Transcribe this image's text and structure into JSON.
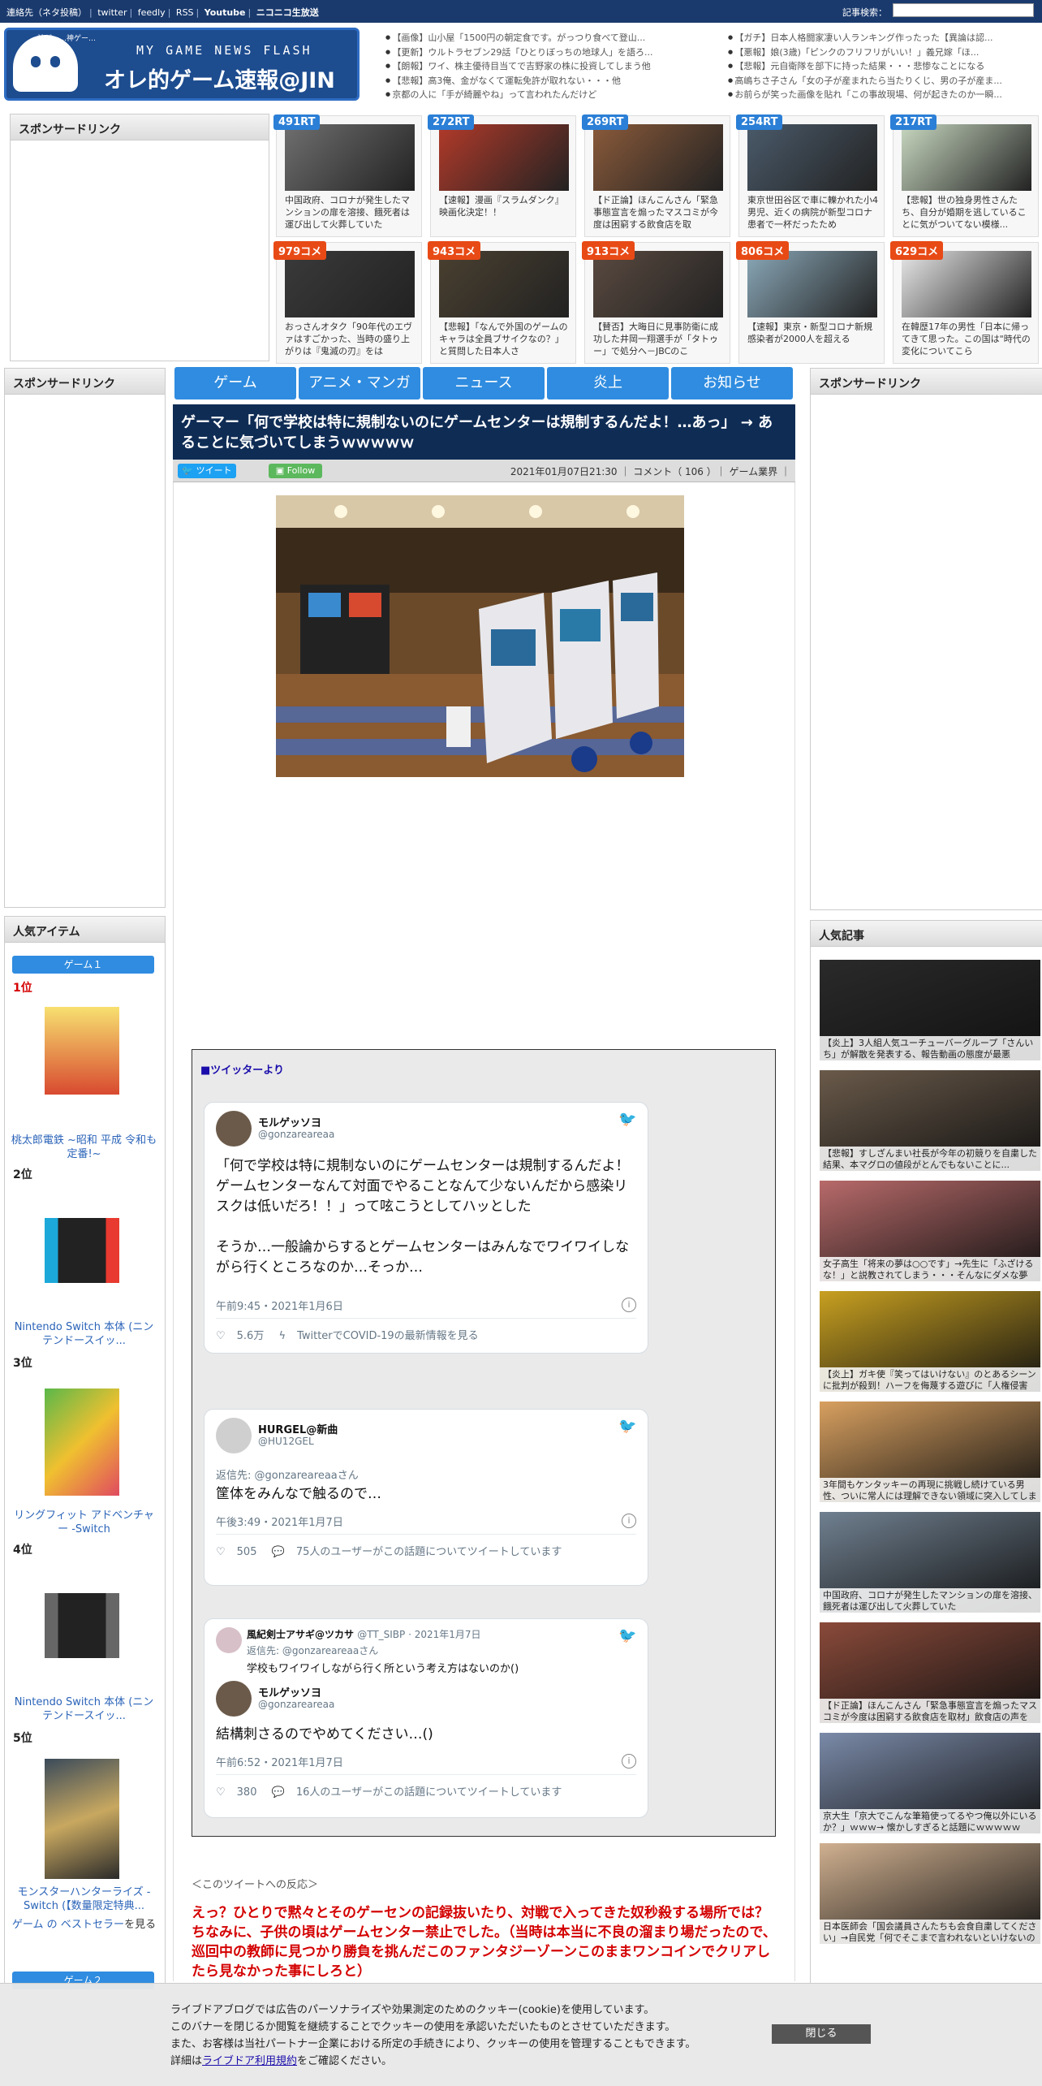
{
  "topbar": {
    "links": [
      "連絡先（ネタ投稿）",
      "twitter",
      "feedly",
      "RSS",
      "Youtube",
      "ニコニコ生放送"
    ],
    "search_label": "記事検索："
  },
  "logo": {
    "top": "MY GAME NEWS FLASH",
    "main": "オレ的ゲーム速報@JIN",
    "side": "神ゲー…神ゲー…"
  },
  "headlines_left": [
    "【画像】山小屋「1500円の朝定食です。がっつり食べて登山...",
    "【更新】ウルトラセブン29話「ひとりぼっちの地球人」を語ろ...",
    "【朗報】ワイ、株主優待目当てで吉野家の株に投資してしまう他",
    "【悲報】高3俺、金がなくて運転免許が取れない・・・他",
    "京都の人に「手が綺麗やね」って言われたんだけど"
  ],
  "headlines_right": [
    "【ガチ】日本人格闘家凄い人ランキング作ったった【異論は認...",
    "【悪報】娘(3歳)「ピンクのフリフリがいい！」義兄嫁「ほ...",
    "【悲報】元自衛隊を部下に持った結果・・・悲惨なことになる",
    "高嶋ちさ子さん「女の子が産まれたら当たりくじ、男の子が産ま...",
    "お前らが笑った画像を貼れ「この事故現場、何が起きたのか一瞬..."
  ],
  "sponsor_title": "スポンサードリンク",
  "thumbs": [
    {
      "badge": "491RT",
      "type": "rt",
      "caption": "中国政府、コロナが発生したマンションの扉を溶接、餓死者は運び出して火葬していた",
      "color": "#6f6f6f"
    },
    {
      "badge": "272RT",
      "type": "rt",
      "caption": "【速報】漫画『スラムダンク』映画化決定！！",
      "color": "#b23a2a"
    },
    {
      "badge": "269RT",
      "type": "rt",
      "caption": "【ド正論】ほんこんさん「緊急事態宣言を煽ったマスコミが今度は困窮する飲食店を取",
      "color": "#8a5a3a"
    },
    {
      "badge": "254RT",
      "type": "rt",
      "caption": "東京世田谷区で車に轢かれた小4男児、近くの病院が新型コロナ患者で一杯だったため",
      "color": "#4a5a6a"
    },
    {
      "badge": "217RT",
      "type": "rt",
      "caption": "【悲報】世の独身男性さんたち、自分が婚期を逃していることに気がついてない模様...",
      "color": "#c8d8c0"
    },
    {
      "badge": "979コメ",
      "type": "kome",
      "caption": "おっさんオタク「90年代のエヴァはすごかった、当時の盛り上がりは『鬼滅の刃』をは",
      "color": "#3a3a3a"
    },
    {
      "badge": "943コメ",
      "type": "kome",
      "caption": "【悲報】「なんで外国のゲームのキャラは全員ブサイクなの？」と質問した日本人さ",
      "color": "#4a4030"
    },
    {
      "badge": "913コメ",
      "type": "kome",
      "caption": "【賛否】大晦日に見事防衛に成功した井岡一翔選手が「タトゥー」で処分へ－JBCのこ",
      "color": "#5a4a40"
    },
    {
      "badge": "806コメ",
      "type": "kome",
      "caption": "【速報】東京・新型コロナ新規感染者が2000人を超える",
      "color": "#8aa8b8"
    },
    {
      "badge": "629コメ",
      "type": "kome",
      "caption": "在韓歴17年の男性「日本に帰ってきて思った。この国は\"時代の変化についてこら",
      "color": "#e8e8e8"
    }
  ],
  "nav": [
    "ゲーム",
    "アニメ・マンガ",
    "ニュース",
    "炎上",
    "お知らせ"
  ],
  "article": {
    "title": "ゲーマー「何で学校は特に規制ないのにゲームセンターは規制するんだよ！…あっ」 → あることに気づいてしまうｗｗｗｗｗ",
    "tweet_btn": "ツイート",
    "follow_btn": "Follow",
    "meta": "2021年01月07日21:30 ｜ コメント（ 106 ）｜ ゲーム業界 ｜"
  },
  "twitter_section": {
    "heading": "■ツイッターより",
    "tweets": [
      {
        "name": "モルゲッソヨ",
        "handle": "@gonzareareaa",
        "text": "「何で学校は特に規制ないのにゲームセンターは規制するんだよ！ゲームセンターなんて対面でやることなんて少ないんだから感染リスクは低いだろ！！」って呟こうとしてハッとした\n\nそうか…一般論からするとゲームセンターはみんなでワイワイしながら行くところなのか…そっか…",
        "date": "午前9:45・2021年1月6日",
        "likes": "5.6万",
        "foot": "TwitterでCOVID-19の最新情報を見る"
      },
      {
        "name": "HURGEL@新曲",
        "handle": "@HU12GEL",
        "reply_to": "返信先: @gonzareareaaさん",
        "text": "筐体をみんなで触るので…",
        "date": "午後3:49・2021年1月7日",
        "likes": "505",
        "foot": "75人のユーザーがこの話題についてツイートしています"
      },
      {
        "quoted_name": "風紀剣士アサギ@ツカサ",
        "quoted_handle": "@TT_SIBP · 2021年1月7日",
        "quoted_reply": "返信先: @gonzareareaaさん",
        "quoted_text": "学校もワイワイしながら行く所という考え方はないのか()",
        "name": "モルゲッソヨ",
        "handle": "@gonzareareaa",
        "text": "結構刺さるのでやめてください…()",
        "date": "午前6:52・2021年1月7日",
        "likes": "380",
        "foot": "16人のユーザーがこの話題についてツイートしています"
      }
    ]
  },
  "reaction_label": "＜このツイートへの反応＞",
  "reaction_text": "えっ？ひとりで黙々とそのゲーセンの記録抜いたり、対戦で入ってきた奴秒殺する場所では？ちなみに、子供の頃はゲームセンター禁止でした。（当時は本当に不良の溜まり場だったので、巡回中の教師に見つかり勝負を挑んだこのファンタジーゾーンこのままワンコインでクリアしたら見なかった事にしろと）",
  "left_ranking": {
    "title": "人気アイテム",
    "tab1": "ゲーム１",
    "tab2": "ゲーム２",
    "items": [
      {
        "rank": "1位",
        "caption": "桃太郎電鉄 ~昭和 平成 令和も定番!~"
      },
      {
        "rank": "2位",
        "caption": "Nintendo Switch 本体 (ニンテンドースイッ..."
      },
      {
        "rank": "3位",
        "caption": "リングフィット アドベンチャー -Switch"
      },
      {
        "rank": "4位",
        "caption": "Nintendo Switch 本体 (ニンテンドースイッ..."
      },
      {
        "rank": "5位",
        "caption": "モンスターハンターライズ -Switch (【数量限定特典..."
      }
    ],
    "bestseller_pre": "ゲーム の ベストセラー",
    "bestseller_post": "を見る"
  },
  "right_popular": {
    "title": "人気記事",
    "items": [
      "【炎上】3人組人気ユーチューバーグループ「さんいち」が解散を発表する、報告動画の態度が最悪",
      "【悲報】すしざんまい社長が今年の初競りを自粛した結果、本マグロの値段がとんでもないことに...",
      "女子高生「将来の夢は○○です」→先生に「ふざけるな！」と説教されてしまう・・・そんなにダメな夢か？",
      "【炎上】ガキ使『笑ってはいけない』のとあるシーンに批判が殺到！ハーフを侮蔑する遊びに「人権侵害だ」",
      "3年間もケンタッキーの再現に挑戦し続けている男性、ついに常人には理解できない領域に突入してしまう",
      "中国政府、コロナが発生したマンションの扉を溶接、餓死者は運び出して火葬していた",
      "【ド正論】ほんこんさん「緊急事態宣言を煽ったマスコミが今度は困窮する飲食店を取材」飲食店の声を",
      "京大生「京大でこんな筆箱使ってるやつ俺以外にいるか？」ｗｗｗ→ 懐かしすぎると話題にｗｗｗｗｗ",
      "日本医師会「国会議員さんたちも会食自粛してください」→自民党「何でそこまで言われないといけないのか」"
    ]
  },
  "cookie": {
    "lines": [
      "ライブドアブログでは広告のパーソナライズや効果測定のためのクッキー(cookie)を使用しています。",
      "このバナーを閉じるか閲覧を継続することでクッキーの使用を承認いただいたものとさせていただきます。",
      "また、お客様は当社パートナー企業における所定の手続きにより、クッキーの使用を管理することもできます。"
    ],
    "detail_pre": "詳細は",
    "detail_link": "ライブドア利用規約",
    "detail_post": "をご確認ください。",
    "close": "閉じる"
  }
}
